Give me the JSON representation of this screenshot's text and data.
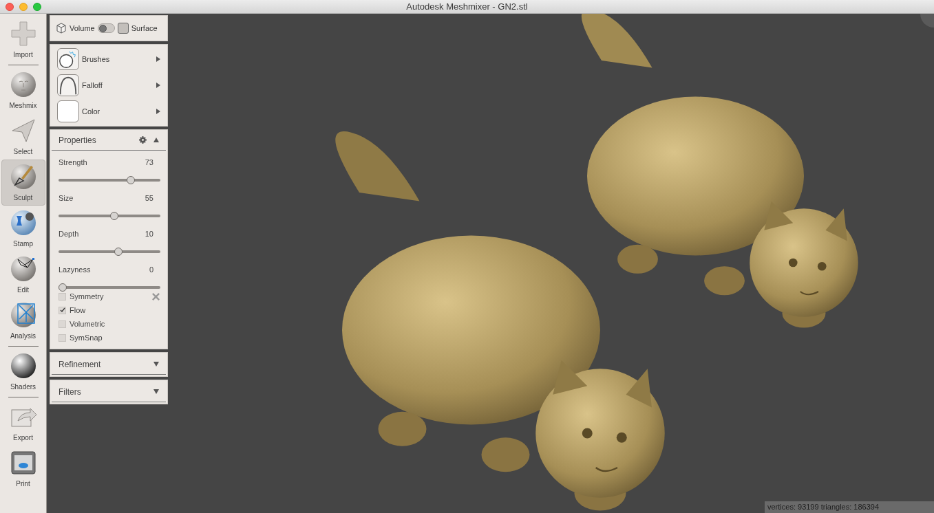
{
  "window": {
    "title": "Autodesk Meshmixer - GN2.stl"
  },
  "toolbar_groups": [
    [
      {
        "label": "Import",
        "kind": "plus",
        "selected": false
      }
    ],
    [
      {
        "label": "Meshmix",
        "kind": "face",
        "selected": false
      },
      {
        "label": "Select",
        "kind": "arrow",
        "selected": false
      },
      {
        "label": "Sculpt",
        "kind": "brush",
        "selected": true
      },
      {
        "label": "Stamp",
        "kind": "stamp",
        "selected": false
      },
      {
        "label": "Edit",
        "kind": "edit",
        "selected": false
      },
      {
        "label": "Analysis",
        "kind": "analysis",
        "selected": false
      }
    ],
    [
      {
        "label": "Shaders",
        "kind": "shader",
        "selected": false
      }
    ],
    [
      {
        "label": "Export",
        "kind": "export",
        "selected": false
      },
      {
        "label": "Print",
        "kind": "print",
        "selected": false
      }
    ]
  ],
  "mode": {
    "left_label": "Volume",
    "right_label": "Surface",
    "on": false
  },
  "brush_rows": [
    {
      "label": "Brushes",
      "kind": "brushes"
    },
    {
      "label": "Falloff",
      "kind": "falloff"
    },
    {
      "label": "Color",
      "kind": "color"
    }
  ],
  "properties": {
    "title": "Properties",
    "expanded": true,
    "sliders": [
      {
        "label": "Strength",
        "reading": "73",
        "level": 0.71
      },
      {
        "label": "Size",
        "reading": "55",
        "level": 0.55
      },
      {
        "label": "Depth",
        "reading": "10",
        "level": 0.59
      },
      {
        "label": "Lazyness",
        "reading": "0",
        "level": 0
      }
    ],
    "checkboxes": [
      {
        "label": "Symmetry",
        "checked": false,
        "has_tool": true
      },
      {
        "label": "Flow",
        "checked": true,
        "has_tool": false
      },
      {
        "label": "Volumetric",
        "checked": false,
        "has_tool": false
      },
      {
        "label": "SymSnap",
        "checked": false,
        "has_tool": false
      }
    ]
  },
  "collapsed_panels": [
    {
      "title": "Refinement",
      "expanded": false
    },
    {
      "title": "Filters",
      "expanded": false
    }
  ],
  "status_bar": "vertices: 93199 triangles: 186394"
}
